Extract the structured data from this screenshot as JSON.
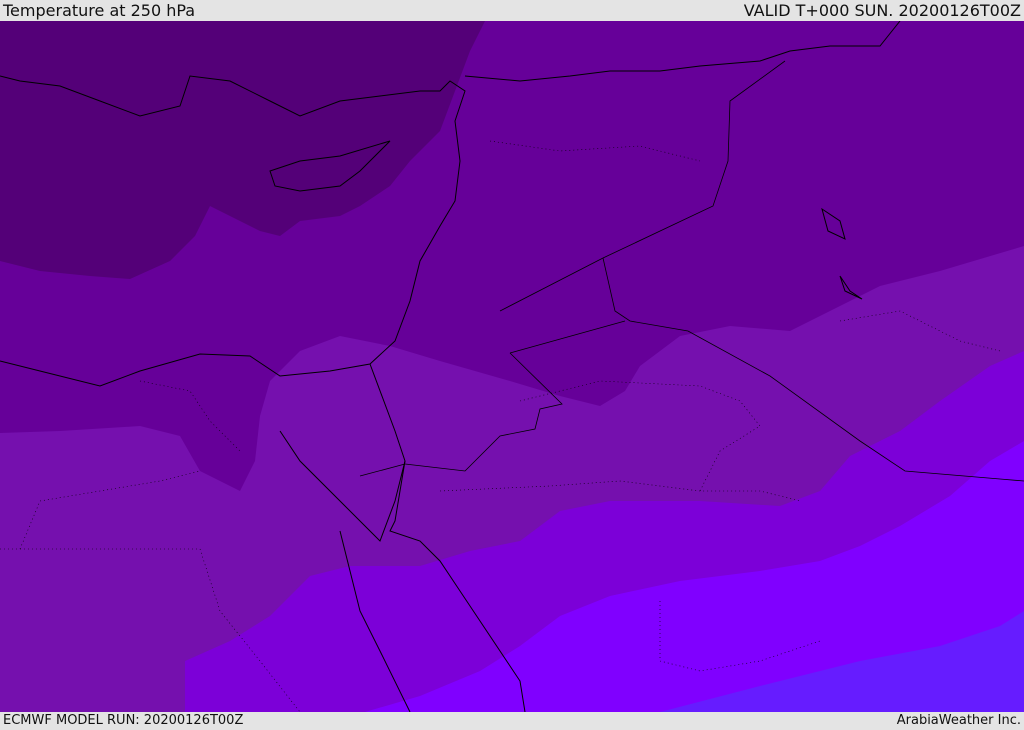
{
  "header": {
    "title": "Temperature at 250 hPa",
    "valid": "VALID T+000 SUN. 20200126T00Z"
  },
  "footer": {
    "model_run": "ECMWF MODEL RUN: 20200126T00Z",
    "credit": "ArabiaWeather Inc."
  },
  "colors": {
    "band1": "#540078",
    "band2": "#660099",
    "band3": "#7510ae",
    "band4": "#7c00d8",
    "band5": "#8000ff",
    "band6": "#661cff",
    "background": "#e4e4e4"
  }
}
